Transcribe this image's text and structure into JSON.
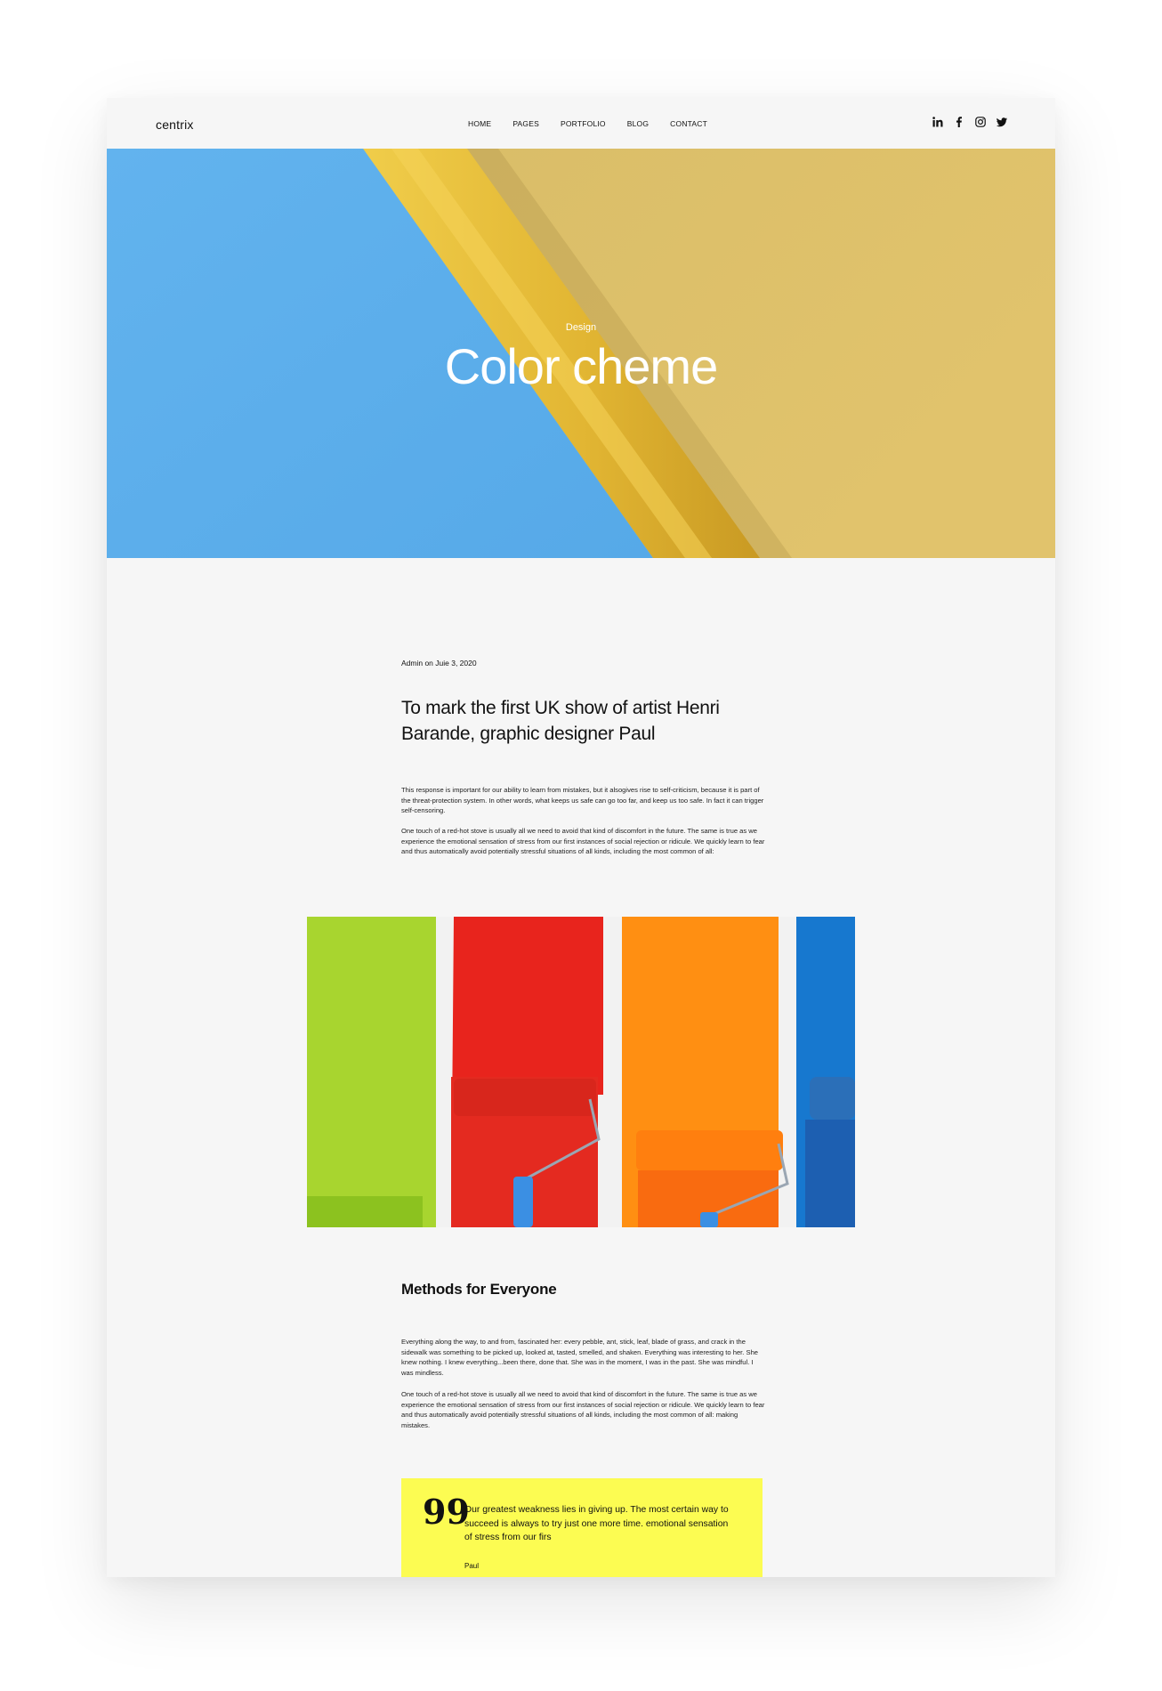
{
  "header": {
    "logo": "centrix",
    "nav": [
      "HOME",
      "PAGES",
      "PORTFOLIO",
      "BLOG",
      "CONTACT"
    ],
    "social_icons": [
      "linkedin-icon",
      "facebook-icon",
      "instagram-icon",
      "twitter-icon"
    ]
  },
  "hero": {
    "category": "Design",
    "title": "Color cheme",
    "colors": {
      "blue": "#5fb0ec",
      "yellow": "#e6c347",
      "sand": "#dcc06e"
    }
  },
  "article": {
    "meta": "Admin on Juie 3, 2020",
    "title": "To mark the first UK show of artist Henri Barande, graphic designer Paul",
    "paragraph_1": "This response is important for our ability to learn from mistakes, but it alsogives rise to self-criticism, because it is part of the threat-protection system. In other words, what keeps us safe can go too far, and keep us too safe. In fact it can trigger self-censoring.",
    "paragraph_2": "One touch of a red-hot stove is usually all we need to avoid that kind of discomfort in the future. The same is true as we experience the emotional sensation of stress from our first instances of social rejection or ridicule. We quickly learn to fear and thus automatically avoid potentially stressful situations of all kinds, including the most common of all:",
    "section_title": "Methods for Everyone",
    "paragraph_3": "Everything along the way, to and from, fascinated her: every pebble, ant, stick, leaf, blade of grass, and crack in the sidewalk was something to be picked up, looked at, tasted, smelled, and shaken. Everything was interesting to her. She knew nothing. I knew everything...been there, done that. She was in the moment, I was in the past. She was mindful. I was mindless.",
    "paragraph_4": "One touch of a red-hot stove is usually all we need to avoid that kind of discomfort in the future. The same is true as we experience the emotional sensation of stress from our first instances of social rejection or ridicule. We quickly learn to fear and thus automatically avoid potentially stressful situations of all kinds, including the most common of all: making mistakes."
  },
  "quote": {
    "mark": "99",
    "text": "Our greatest weakness lies in giving up. The most certain way to succeed is always to try just one more time. emotional sensation of stress from our firs",
    "author": "Paul",
    "background": "#fcfc52"
  }
}
